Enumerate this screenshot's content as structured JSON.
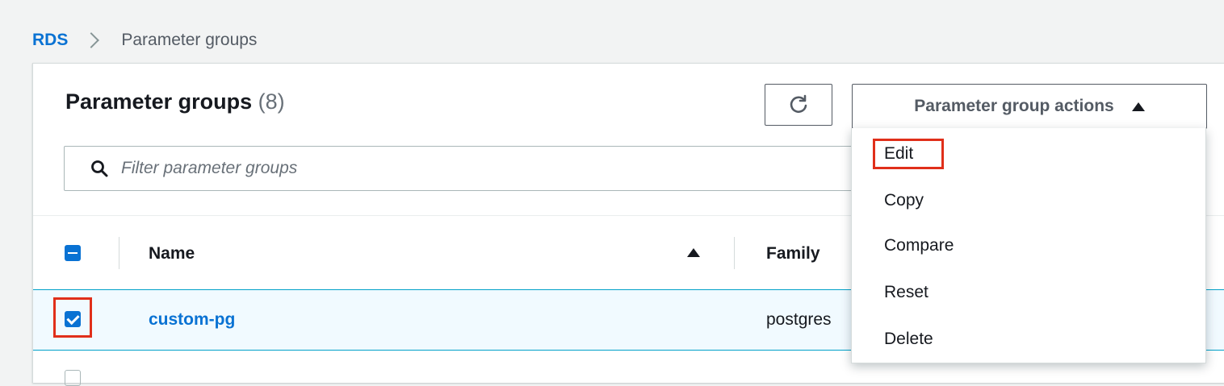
{
  "breadcrumb": {
    "root": "RDS",
    "current": "Parameter groups"
  },
  "panel": {
    "title": "Parameter groups",
    "count": "(8)"
  },
  "toolbar": {
    "refresh_icon": "refresh-icon",
    "actions_label": "Parameter group actions"
  },
  "search": {
    "placeholder": "Filter parameter groups",
    "value": ""
  },
  "table": {
    "columns": [
      "Name",
      "Family"
    ],
    "sort_column": "Name",
    "sort_direction": "ascending",
    "rows": [
      {
        "name": "custom-pg",
        "family": "postgres",
        "selected": true
      }
    ]
  },
  "dropdown": {
    "items": [
      "Edit",
      "Copy",
      "Compare",
      "Reset",
      "Delete"
    ]
  },
  "colors": {
    "accent": "#0972d3",
    "highlight": "#e02f1a",
    "selected_row_bg": "#f1faff"
  }
}
